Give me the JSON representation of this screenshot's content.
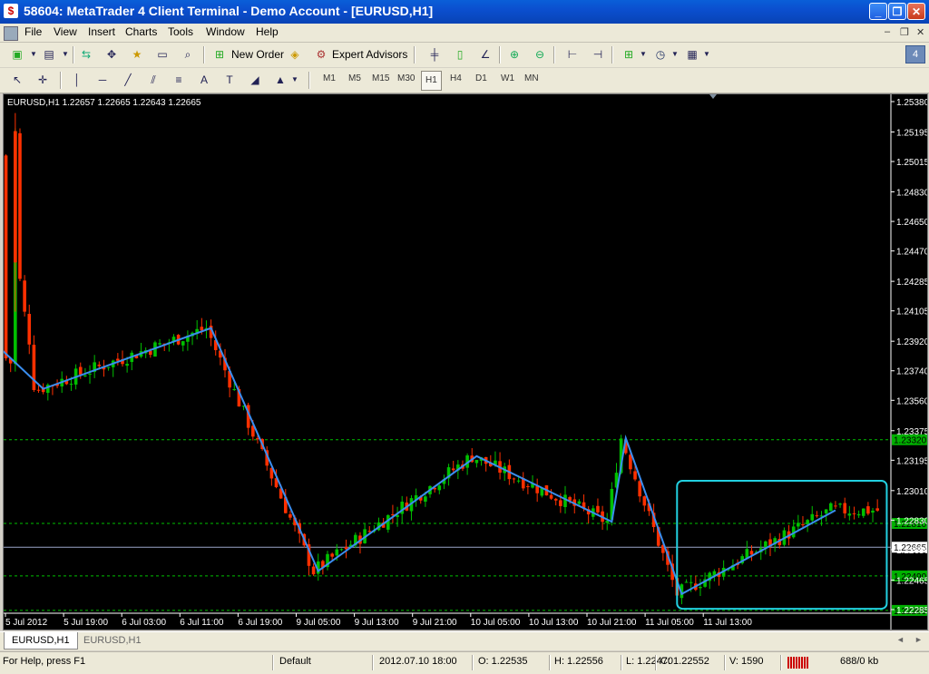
{
  "window": {
    "title": "58604: MetaTrader 4 Client Terminal - Demo Account - [EURUSD,H1]",
    "app_icon": "$",
    "buttons": {
      "minimize": "_",
      "restore": "❐",
      "close": "✕"
    }
  },
  "menu": {
    "items": [
      "File",
      "View",
      "Insert",
      "Charts",
      "Tools",
      "Window",
      "Help"
    ],
    "mdi_buttons": [
      "–",
      "❐",
      "✕"
    ]
  },
  "toolbar1": {
    "new_order": "New Order",
    "expert_advisors": "Expert Advisors",
    "badge": "4"
  },
  "toolbar2": {
    "timeframes": [
      "M1",
      "M5",
      "M15",
      "M30",
      "H1",
      "H4",
      "D1",
      "W1",
      "MN"
    ],
    "active_timeframe": "H1",
    "text_tool": "A"
  },
  "chart_data": {
    "type": "candlestick",
    "symbol_info": "EURUSD,H1  1.22657 1.22665 1.22643 1.22665",
    "price_ticks": [
      "1.25380",
      "1.25195",
      "1.25015",
      "1.24830",
      "1.24650",
      "1.24470",
      "1.24285",
      "1.24105",
      "1.23920",
      "1.23740",
      "1.23560",
      "1.23375",
      "1.23195",
      "1.23010",
      "1.22830",
      "1.22650",
      "1.22465",
      "1.22285"
    ],
    "price_range": [
      1.22285,
      1.2538
    ],
    "time_labels": [
      "5 Jul 2012",
      "5 Jul 19:00",
      "6 Jul 03:00",
      "6 Jul 11:00",
      "6 Jul 19:00",
      "9 Jul 05:00",
      "9 Jul 13:00",
      "9 Jul 21:00",
      "10 Jul 05:00",
      "10 Jul 13:00",
      "10 Jul 21:00",
      "11 Jul 05:00",
      "11 Jul 13:00"
    ],
    "current_price": "1.22665",
    "level_lines": [
      {
        "price": 1.2332,
        "label": "1.23320"
      },
      {
        "price": 1.2281,
        "label": "1.22810"
      },
      {
        "price": 1.2249,
        "label": "1.22490"
      },
      {
        "price": 1.2228,
        "label": "1.22285"
      }
    ],
    "zigzag": [
      {
        "bar": -1,
        "price": 1.2387
      },
      {
        "bar": 8,
        "price": 1.2363
      },
      {
        "bar": 44,
        "price": 1.24
      },
      {
        "bar": 67,
        "price": 1.2252
      },
      {
        "bar": 101,
        "price": 1.2322
      },
      {
        "bar": 130,
        "price": 1.2282
      },
      {
        "bar": 133,
        "price": 1.2333
      },
      {
        "bar": 145,
        "price": 1.2238
      },
      {
        "bar": 178,
        "price": 1.2289
      }
    ],
    "highlight_box": {
      "bar_from": 144,
      "bar_to": 189,
      "price_from": 1.2229,
      "price_to": 1.2307
    },
    "colors": {
      "bull": "#00c000",
      "bear": "#ff3000",
      "zigzag": "#3a8ef0",
      "level": "#00c000",
      "box": "#22d0e0"
    }
  },
  "tabs": [
    "EURUSD,H1",
    "EURUSD,H1"
  ],
  "status": {
    "help": "For Help, press F1",
    "profile": "Default",
    "datetime": "2012.07.10 18:00",
    "open": "O: 1.22535",
    "high": "H: 1.22556",
    "low": "L: 1.22470",
    "close": "C: 1.22552",
    "volume": "V: 1590",
    "traffic": "688/0 kb"
  }
}
